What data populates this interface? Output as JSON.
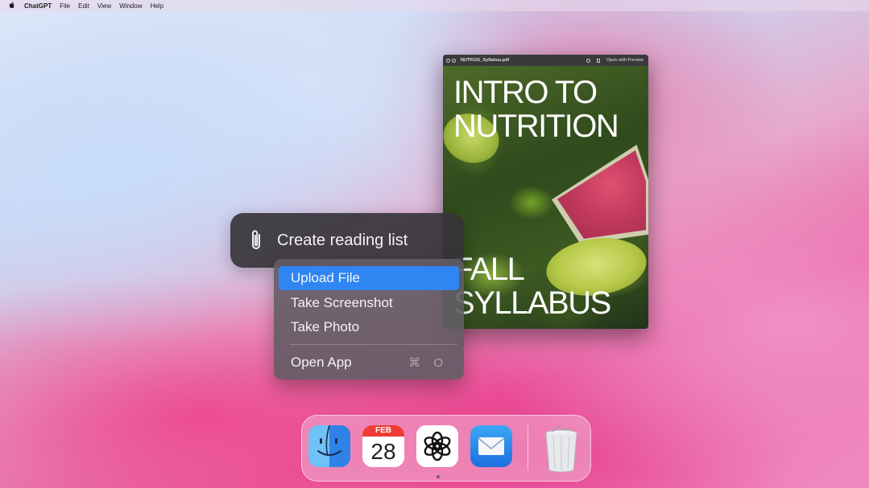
{
  "menubar": {
    "apple_icon": "apple-logo-icon",
    "app_name": "ChatGPT",
    "items": [
      "File",
      "Edit",
      "View",
      "Window",
      "Help"
    ]
  },
  "prompt": {
    "icon": "paperclip-icon",
    "text": "Create reading list"
  },
  "context_menu": {
    "items": [
      {
        "label": "Upload File",
        "selected": true
      },
      {
        "label": "Take Screenshot",
        "selected": false
      },
      {
        "label": "Take Photo",
        "selected": false
      },
      {
        "label": "Open App",
        "shortcut": "⌘ O",
        "selected": false
      }
    ]
  },
  "preview_window": {
    "title": "NUTR101_Syllabus.pdf",
    "open_with": "Open with Preview",
    "cover_title": "INTRO TO\nNUTRITION",
    "cover_subtitle": "FALL\nSYLLABUS"
  },
  "dock": {
    "apps": [
      "finder-icon",
      "calendar-icon",
      "chatgpt-icon",
      "mail-icon",
      "trash-icon"
    ],
    "calendar_month": "FEB",
    "calendar_day": "28"
  },
  "colors": {
    "selection": "#2f86f2",
    "menu_bg": "#625c64",
    "pill_bg": "#37343a"
  }
}
